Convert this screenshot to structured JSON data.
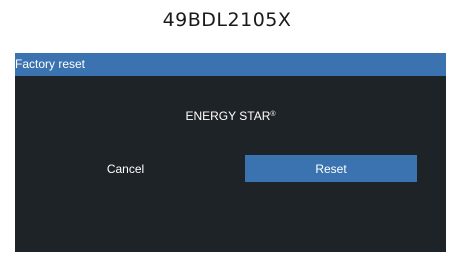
{
  "header": {
    "model_name": "49BDL2105X"
  },
  "dialog": {
    "title": "Factory reset",
    "message": "ENERGY STAR",
    "message_mark": "®",
    "cancel_label": "Cancel",
    "reset_label": "Reset"
  },
  "colors": {
    "dialog_background": "#1e2328",
    "header_background": "#3a73b0",
    "focused_button": "#3a73b0",
    "text": "#ffffff"
  }
}
